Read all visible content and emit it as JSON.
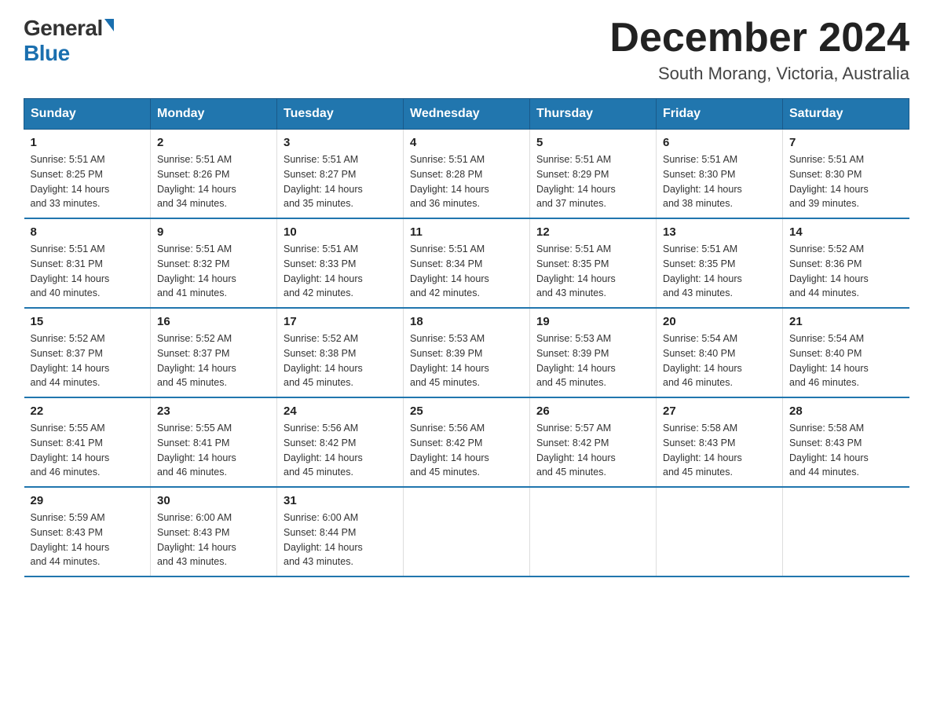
{
  "logo": {
    "general": "General",
    "blue": "Blue"
  },
  "title": "December 2024",
  "subtitle": "South Morang, Victoria, Australia",
  "days_of_week": [
    "Sunday",
    "Monday",
    "Tuesday",
    "Wednesday",
    "Thursday",
    "Friday",
    "Saturday"
  ],
  "weeks": [
    [
      {
        "day": "1",
        "sunrise": "5:51 AM",
        "sunset": "8:25 PM",
        "daylight": "14 hours and 33 minutes."
      },
      {
        "day": "2",
        "sunrise": "5:51 AM",
        "sunset": "8:26 PM",
        "daylight": "14 hours and 34 minutes."
      },
      {
        "day": "3",
        "sunrise": "5:51 AM",
        "sunset": "8:27 PM",
        "daylight": "14 hours and 35 minutes."
      },
      {
        "day": "4",
        "sunrise": "5:51 AM",
        "sunset": "8:28 PM",
        "daylight": "14 hours and 36 minutes."
      },
      {
        "day": "5",
        "sunrise": "5:51 AM",
        "sunset": "8:29 PM",
        "daylight": "14 hours and 37 minutes."
      },
      {
        "day": "6",
        "sunrise": "5:51 AM",
        "sunset": "8:30 PM",
        "daylight": "14 hours and 38 minutes."
      },
      {
        "day": "7",
        "sunrise": "5:51 AM",
        "sunset": "8:30 PM",
        "daylight": "14 hours and 39 minutes."
      }
    ],
    [
      {
        "day": "8",
        "sunrise": "5:51 AM",
        "sunset": "8:31 PM",
        "daylight": "14 hours and 40 minutes."
      },
      {
        "day": "9",
        "sunrise": "5:51 AM",
        "sunset": "8:32 PM",
        "daylight": "14 hours and 41 minutes."
      },
      {
        "day": "10",
        "sunrise": "5:51 AM",
        "sunset": "8:33 PM",
        "daylight": "14 hours and 42 minutes."
      },
      {
        "day": "11",
        "sunrise": "5:51 AM",
        "sunset": "8:34 PM",
        "daylight": "14 hours and 42 minutes."
      },
      {
        "day": "12",
        "sunrise": "5:51 AM",
        "sunset": "8:35 PM",
        "daylight": "14 hours and 43 minutes."
      },
      {
        "day": "13",
        "sunrise": "5:51 AM",
        "sunset": "8:35 PM",
        "daylight": "14 hours and 43 minutes."
      },
      {
        "day": "14",
        "sunrise": "5:52 AM",
        "sunset": "8:36 PM",
        "daylight": "14 hours and 44 minutes."
      }
    ],
    [
      {
        "day": "15",
        "sunrise": "5:52 AM",
        "sunset": "8:37 PM",
        "daylight": "14 hours and 44 minutes."
      },
      {
        "day": "16",
        "sunrise": "5:52 AM",
        "sunset": "8:37 PM",
        "daylight": "14 hours and 45 minutes."
      },
      {
        "day": "17",
        "sunrise": "5:52 AM",
        "sunset": "8:38 PM",
        "daylight": "14 hours and 45 minutes."
      },
      {
        "day": "18",
        "sunrise": "5:53 AM",
        "sunset": "8:39 PM",
        "daylight": "14 hours and 45 minutes."
      },
      {
        "day": "19",
        "sunrise": "5:53 AM",
        "sunset": "8:39 PM",
        "daylight": "14 hours and 45 minutes."
      },
      {
        "day": "20",
        "sunrise": "5:54 AM",
        "sunset": "8:40 PM",
        "daylight": "14 hours and 46 minutes."
      },
      {
        "day": "21",
        "sunrise": "5:54 AM",
        "sunset": "8:40 PM",
        "daylight": "14 hours and 46 minutes."
      }
    ],
    [
      {
        "day": "22",
        "sunrise": "5:55 AM",
        "sunset": "8:41 PM",
        "daylight": "14 hours and 46 minutes."
      },
      {
        "day": "23",
        "sunrise": "5:55 AM",
        "sunset": "8:41 PM",
        "daylight": "14 hours and 46 minutes."
      },
      {
        "day": "24",
        "sunrise": "5:56 AM",
        "sunset": "8:42 PM",
        "daylight": "14 hours and 45 minutes."
      },
      {
        "day": "25",
        "sunrise": "5:56 AM",
        "sunset": "8:42 PM",
        "daylight": "14 hours and 45 minutes."
      },
      {
        "day": "26",
        "sunrise": "5:57 AM",
        "sunset": "8:42 PM",
        "daylight": "14 hours and 45 minutes."
      },
      {
        "day": "27",
        "sunrise": "5:58 AM",
        "sunset": "8:43 PM",
        "daylight": "14 hours and 45 minutes."
      },
      {
        "day": "28",
        "sunrise": "5:58 AM",
        "sunset": "8:43 PM",
        "daylight": "14 hours and 44 minutes."
      }
    ],
    [
      {
        "day": "29",
        "sunrise": "5:59 AM",
        "sunset": "8:43 PM",
        "daylight": "14 hours and 44 minutes."
      },
      {
        "day": "30",
        "sunrise": "6:00 AM",
        "sunset": "8:43 PM",
        "daylight": "14 hours and 43 minutes."
      },
      {
        "day": "31",
        "sunrise": "6:00 AM",
        "sunset": "8:44 PM",
        "daylight": "14 hours and 43 minutes."
      },
      null,
      null,
      null,
      null
    ]
  ],
  "sunrise_label": "Sunrise:",
  "sunset_label": "Sunset:",
  "daylight_label": "Daylight:"
}
